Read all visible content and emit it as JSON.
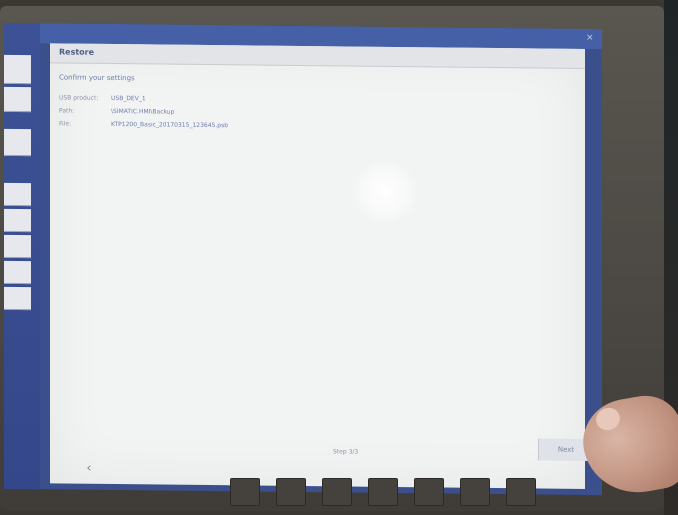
{
  "dialog": {
    "title": "Restore",
    "subtitle": "Confirm your settings",
    "settings": [
      {
        "key": "USB product:",
        "value": "USB_DEV_1"
      },
      {
        "key": "Path:",
        "value": "\\SIMATIC.HMI\\Backup"
      },
      {
        "key": "File:",
        "value": "KTP1200_Basic_20170315_123645.psb"
      }
    ],
    "page_indicator": "Step 3/3",
    "back_label": "‹",
    "next_label": "Next"
  },
  "window": {
    "close_label": "×"
  },
  "colors": {
    "rail": "#3d5296",
    "dialog_bg": "#f2f3f3",
    "title_text": "#4f5e86"
  }
}
